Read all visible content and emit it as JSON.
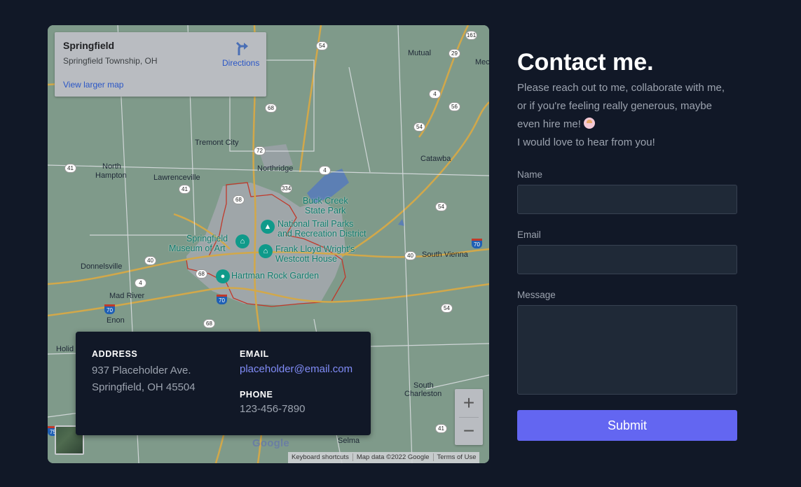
{
  "map": {
    "place_name": "Springfield",
    "place_sub": "Springfield Township, OH",
    "directions_label": "Directions",
    "view_larger_label": "View larger map",
    "zoom_in": "+",
    "zoom_out": "−",
    "google_logo": "Google",
    "attribution": [
      "Keyboard shortcuts",
      "Map data ©2022 Google",
      "Terms of Use"
    ],
    "towns": {
      "tremont_city": "Tremont City",
      "north_hampton_1": "North",
      "north_hampton_2": "Hampton",
      "lawrenceville": "Lawrenceville",
      "northridge": "Northridge",
      "mutual": "Mutual",
      "catawba": "Catawba",
      "donnelsville": "Donnelsville",
      "south_vienna": "South Vienna",
      "mad_river": "Mad River",
      "enon": "Enon",
      "holid": "Holid",
      "south_charleston_1": "South",
      "south_charleston_2": "Charleston",
      "selma": "Selma",
      "mec": "Mec"
    },
    "pois": {
      "buck_creek_1": "Buck Creek",
      "buck_creek_2": "State Park",
      "national_trail_1": "National Trail Parks",
      "national_trail_2": "and Recreation District",
      "museum_1": "Springfield",
      "museum_2": "Museum of Art",
      "westcott_1": "Frank Lloyd Wright's",
      "westcott_2": "Westcott House",
      "hartman": "Hartman Rock Garden"
    },
    "routes": [
      "161",
      "54",
      "29",
      "4",
      "56",
      "54",
      "68",
      "72",
      "41",
      "4",
      "41",
      "334",
      "68",
      "54",
      "40",
      "68",
      "40",
      "4",
      "70",
      "70",
      "68",
      "54",
      "41",
      "70",
      "75"
    ]
  },
  "contact_card": {
    "address_heading": "ADDRESS",
    "address_line1": "937 Placeholder Ave.",
    "address_line2": "Springfield, OH 45504",
    "email_heading": "EMAIL",
    "email": "placeholder@email.com",
    "phone_heading": "PHONE",
    "phone": "123-456-7890"
  },
  "form": {
    "heading": "Contact me.",
    "intro_line1": "Please reach out to me, collaborate with me,",
    "intro_line2": "or if you're feeling really generous, maybe",
    "intro_line3": "even hire me!",
    "intro_line4": "I would love to hear from you!",
    "name_label": "Name",
    "name_value": "",
    "email_label": "Email",
    "email_value": "",
    "message_label": "Message",
    "message_value": "",
    "submit_label": "Submit"
  },
  "colors": {
    "background": "#111827",
    "accent": "#6366f1",
    "link": "#818cf8",
    "field": "#1f2937"
  }
}
